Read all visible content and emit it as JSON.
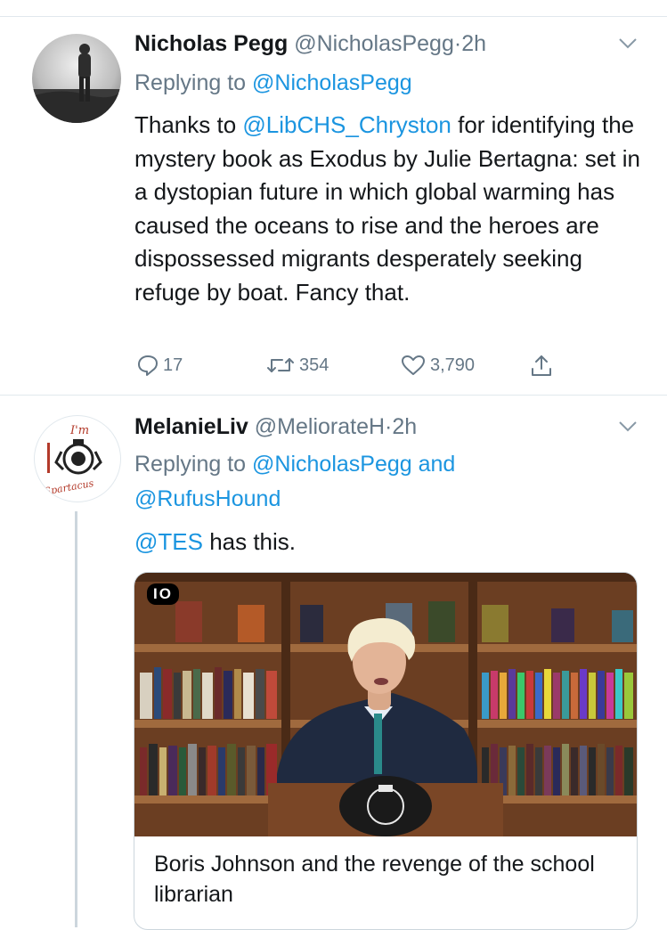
{
  "tweets": [
    {
      "name": "Nicholas Pegg",
      "handle": "@NicholasPegg",
      "separator": "·",
      "time": "2h",
      "replying_prefix": "Replying to",
      "replying_to": "@NicholasPegg",
      "body_parts": {
        "pre": "Thanks to ",
        "mention": "@LibCHS_Chryston",
        "post": " for identifying the mystery book as Exodus by Julie Bertagna: set in a dystopian future in which global warming has caused the oceans to rise and the heroes are dispossessed migrants desperately seeking refuge by boat. Fancy that."
      },
      "stats": {
        "replies": "17",
        "retweets": "354",
        "likes": "3,790"
      }
    },
    {
      "name": "MelanieLiv",
      "handle": "@MeliorateH",
      "separator": "·",
      "time": "2h",
      "replying_prefix": "Replying to",
      "replying_to_1": "@NicholasPegg",
      "replying_and": "and",
      "replying_to_2": "@RufusHound",
      "avatar_text_top": "I'm",
      "avatar_text_bottom": "Spartacus",
      "body_parts": {
        "mention": "@TES",
        "post": " has this."
      },
      "card": {
        "video_badge": "IO",
        "title": "Boris Johnson and the revenge of the school librarian"
      }
    }
  ],
  "colors": {
    "link": "#1b95e0",
    "secondary": "#657786",
    "divider": "#e1e8ed"
  },
  "icons": [
    "chevron-down-icon",
    "reply-icon",
    "retweet-icon",
    "like-icon",
    "share-icon"
  ]
}
